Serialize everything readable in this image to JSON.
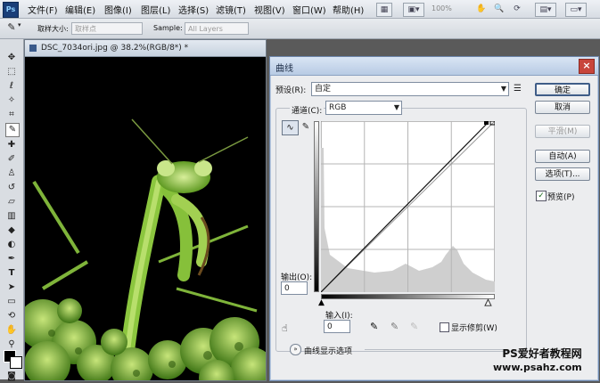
{
  "menubar": {
    "logo": "Ps",
    "items": [
      "文件(F)",
      "编辑(E)",
      "图像(I)",
      "图层(L)",
      "选择(S)",
      "滤镜(T)",
      "视图(V)",
      "窗口(W)",
      "帮助(H)"
    ],
    "zoom": "100%"
  },
  "options": {
    "sample_size_label": "取样大小:",
    "sample_size_value": "取样点",
    "sample_label": "Sample:",
    "sample_value": "All Layers"
  },
  "document": {
    "title": "DSC_7034ori.jpg @ 38.2%(RGB/8*) *"
  },
  "dialog": {
    "title": "曲线",
    "preset_label": "预设(R):",
    "preset_value": "自定",
    "channel_label": "通道(C):",
    "channel_value": "RGB",
    "output_label": "输出(O):",
    "output_value": "0",
    "input_label": "输入(I):",
    "input_value": "0",
    "show_clipping_label": "显示修剪(W)",
    "curve_display_options": "曲线显示选项",
    "buttons": {
      "ok": "确定",
      "cancel": "取消",
      "smooth": "平滑(M)",
      "auto": "自动(A)",
      "options": "选项(T)..."
    },
    "preview_label": "预览(P)",
    "preview_checked": true,
    "show_clipping_checked": false
  },
  "watermark": {
    "line1": "PS爱好者教程网",
    "line2": "www.psahz.com"
  },
  "colors": {
    "dialog_bg": "#ecedef",
    "title_blue": "#b8cbe4",
    "close_red": "#c8453b",
    "mantis_green": "#8cc63f"
  }
}
